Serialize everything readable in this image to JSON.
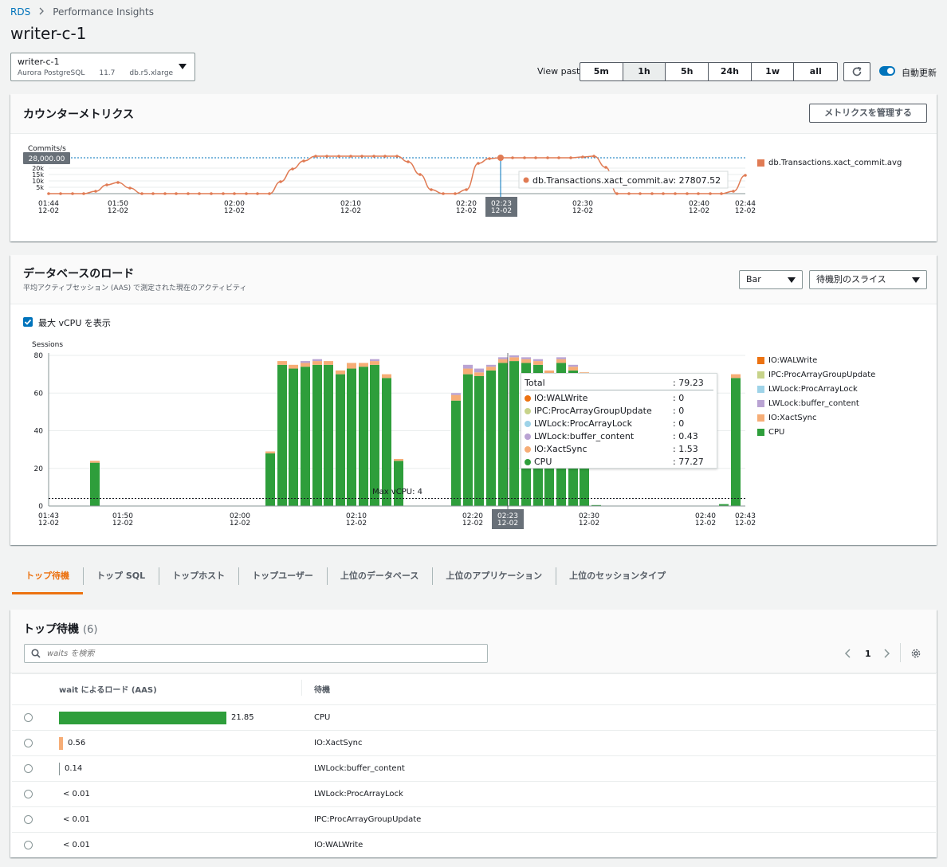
{
  "breadcrumb": {
    "root": "RDS",
    "current": "Performance Insights"
  },
  "page_title": "writer-c-1",
  "instance_select": {
    "name": "writer-c-1",
    "engine": "Aurora PostgreSQL",
    "version": "11.7",
    "class": "db.r5.xlarge"
  },
  "view_past": {
    "label": "View past",
    "options": [
      "5m",
      "1h",
      "5h",
      "24h",
      "1w",
      "all"
    ],
    "selected": "1h"
  },
  "auto_refresh_label": "自動更新",
  "counter_panel": {
    "title": "カウンターメトリクス",
    "manage_button": "メトリクスを管理する",
    "y_label": "Commits/s",
    "y_ticks": [
      "20k",
      "15k",
      "10k",
      "5k"
    ],
    "threshold_label": "28,000.00",
    "legend": "db.Transactions.xact_commit.avg",
    "tooltip": "db.Transactions.xact_commit.av: 27807.52",
    "x_ticks": [
      {
        "t": "01:44",
        "d": "12-02"
      },
      {
        "t": "01:50",
        "d": "12-02"
      },
      {
        "t": "02:00",
        "d": "12-02"
      },
      {
        "t": "02:10",
        "d": "12-02"
      },
      {
        "t": "02:20",
        "d": "12-02"
      },
      {
        "t": "02:23",
        "d": "12-02"
      },
      {
        "t": "02:30",
        "d": "12-02"
      },
      {
        "t": "02:40",
        "d": "12-02"
      },
      {
        "t": "02:44",
        "d": "12-02"
      }
    ]
  },
  "load_panel": {
    "title": "データベースのロード",
    "subtitle": "平均アクティブセッション (AAS) で測定された現在のアクティビティ",
    "chart_type_select": "Bar",
    "slice_select": "待機別のスライス",
    "max_vcpu_checkbox": "最大 vCPU を表示",
    "y_label": "Sessions",
    "y_ticks": [
      "80",
      "60",
      "40",
      "20",
      "0"
    ],
    "max_vcpu_label": "Max vCPU: 4",
    "x_ticks": [
      {
        "t": "01:43",
        "d": "12-02"
      },
      {
        "t": "01:50",
        "d": "12-02"
      },
      {
        "t": "02:00",
        "d": "12-02"
      },
      {
        "t": "02:10",
        "d": "12-02"
      },
      {
        "t": "02:20",
        "d": "12-02"
      },
      {
        "t": "02:23",
        "d": "12-02"
      },
      {
        "t": "02:30",
        "d": "12-02"
      },
      {
        "t": "02:40",
        "d": "12-02"
      },
      {
        "t": "02:43",
        "d": "12-02"
      }
    ],
    "legend": [
      {
        "name": "IO:WALWrite",
        "color": "#ec7211"
      },
      {
        "name": "IPC:ProcArrayGroupUpdate",
        "color": "#c7d38a"
      },
      {
        "name": "LWLock:ProcArrayLock",
        "color": "#9ed3e8"
      },
      {
        "name": "LWLock:buffer_content",
        "color": "#b9a3d3"
      },
      {
        "name": "IO:XactSync",
        "color": "#f6ad76"
      },
      {
        "name": "CPU",
        "color": "#2e9e3b"
      }
    ],
    "tooltip": {
      "total_label": "Total",
      "total_value": ": 79.23",
      "rows": [
        {
          "name": "IO:WALWrite",
          "value": ": 0",
          "color": "#ec7211"
        },
        {
          "name": "IPC:ProcArrayGroupUpdate",
          "value": ": 0",
          "color": "#c7d38a"
        },
        {
          "name": "LWLock:ProcArrayLock",
          "value": ": 0",
          "color": "#9ed3e8"
        },
        {
          "name": "LWLock:buffer_content",
          "value": ": 0.43",
          "color": "#b9a3d3"
        },
        {
          "name": "IO:XactSync",
          "value": ": 1.53",
          "color": "#f6ad76"
        },
        {
          "name": "CPU",
          "value": ": 77.27",
          "color": "#2e9e3b"
        }
      ]
    }
  },
  "tabs": [
    "トップ待機",
    "トップ SQL",
    "トップホスト",
    "トップユーザー",
    "上位のデータベース",
    "上位のアプリケーション",
    "上位のセッションタイプ"
  ],
  "top_waits": {
    "title": "トップ待機",
    "count": "(6)",
    "search_placeholder": "waits を検索",
    "page": "1",
    "col_load": "wait によるロード (AAS)",
    "col_wait": "待機",
    "rows": [
      {
        "value": "21.85",
        "wait": "CPU",
        "fraction": 1.0,
        "color": "#2e9e3b"
      },
      {
        "value": "0.56",
        "wait": "IO:XactSync",
        "fraction": 0.026,
        "color": "#f6ad76"
      },
      {
        "value": "0.14",
        "wait": "LWLock:buffer_content",
        "fraction": 0.0064,
        "color": "#879596"
      },
      {
        "value": "< 0.01",
        "wait": "LWLock:ProcArrayLock",
        "fraction": 0,
        "color": "#879596"
      },
      {
        "value": "< 0.01",
        "wait": "IPC:ProcArrayGroupUpdate",
        "fraction": 0,
        "color": "#879596"
      },
      {
        "value": "< 0.01",
        "wait": "IO:WALWrite",
        "fraction": 0,
        "color": "#879596"
      }
    ]
  }
}
